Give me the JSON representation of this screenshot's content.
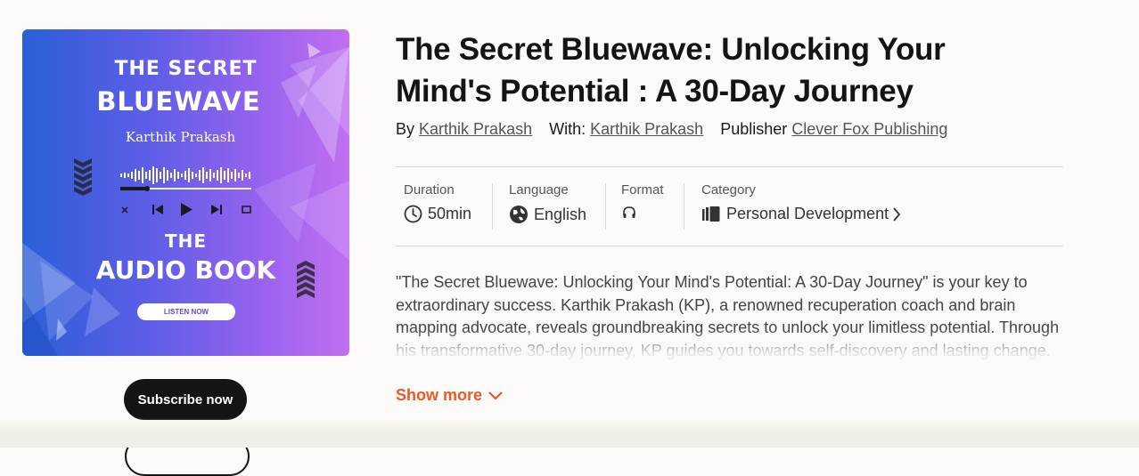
{
  "cover": {
    "title_line1": "THE SECRET",
    "title_line2": "BLUEWAVE",
    "author": "Karthik Prakash",
    "line3": "THE",
    "line4": "AUDIO BOOK",
    "listen_label": "LISTEN NOW"
  },
  "actions": {
    "subscribe_label": "Subscribe now"
  },
  "book": {
    "title": "The Secret Bluewave: Unlocking Your Mind's Potential : A 30-Day Journey",
    "by_label": "By",
    "author": "Karthik Prakash",
    "with_label": "With:",
    "narrator": "Karthik Prakash",
    "publisher_label": "Publisher",
    "publisher": "Clever Fox Publishing"
  },
  "meta": {
    "duration_label": "Duration",
    "duration": "50min",
    "language_label": "Language",
    "language": "English",
    "format_label": "Format",
    "format_icon": "headphones-icon",
    "category_label": "Category",
    "category": "Personal Development"
  },
  "description": "\"The Secret Bluewave: Unlocking Your Mind's Potential: A 30-Day Journey\" is your key to extraordinary success. Karthik Prakash (KP), a renowned recuperation coach and brain mapping advocate, reveals groundbreaking secrets to unlock your limitless potential. Through his transformative 30-day journey, KP guides you towards self-discovery and lasting change.",
  "show_more_label": "Show more",
  "colors": {
    "accent": "#ea5a20",
    "button_bg": "#141414",
    "page_bg": "#fbfaf8"
  }
}
